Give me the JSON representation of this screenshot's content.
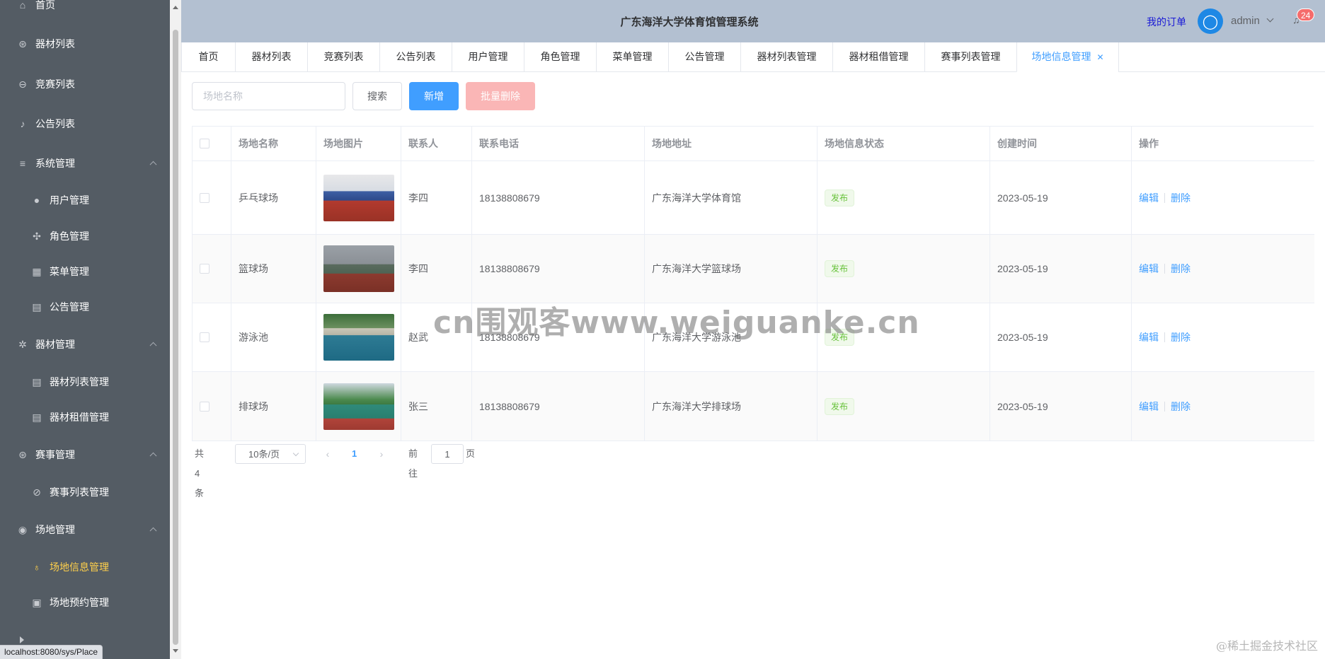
{
  "sidebar": {
    "items": [
      {
        "label": "首页",
        "icon": "home-icon",
        "glyph": "⌂"
      },
      {
        "label": "器材列表",
        "icon": "basketball-icon",
        "glyph": "⊛"
      },
      {
        "label": "竞赛列表",
        "icon": "football-icon",
        "glyph": "⊖"
      },
      {
        "label": "公告列表",
        "icon": "bell-icon",
        "glyph": "♪"
      },
      {
        "label": "系统管理",
        "icon": "sliders-icon",
        "glyph": "≡"
      },
      {
        "label": "用户管理",
        "icon": "user-icon",
        "glyph": "●"
      },
      {
        "label": "角色管理",
        "icon": "rank-icon",
        "glyph": "✣"
      },
      {
        "label": "菜单管理",
        "icon": "menu-grid-icon",
        "glyph": "▦"
      },
      {
        "label": "公告管理",
        "icon": "document-icon",
        "glyph": "▤"
      },
      {
        "label": "器材管理",
        "icon": "gear-icon",
        "glyph": "✲"
      },
      {
        "label": "器材列表管理",
        "icon": "document-icon",
        "glyph": "▤"
      },
      {
        "label": "器材租借管理",
        "icon": "document-icon",
        "glyph": "▤"
      },
      {
        "label": "赛事管理",
        "icon": "basketball-icon",
        "glyph": "⊛"
      },
      {
        "label": "赛事列表管理",
        "icon": "football-icon",
        "glyph": "⊘"
      },
      {
        "label": "场地管理",
        "icon": "location-icon",
        "glyph": "◉"
      },
      {
        "label": "场地信息管理",
        "icon": "user-outline-icon",
        "glyph": "♁"
      },
      {
        "label": "场地预约管理",
        "icon": "tickets-icon",
        "glyph": "▣"
      }
    ]
  },
  "header": {
    "title": "广东海洋大学体育馆管理系统",
    "orders_link": "我的订单",
    "username": "admin",
    "notification_count": "24"
  },
  "tabs": [
    "首页",
    "器材列表",
    "竞赛列表",
    "公告列表",
    "用户管理",
    "角色管理",
    "菜单管理",
    "公告管理",
    "器材列表管理",
    "器材租借管理",
    "赛事列表管理",
    "场地信息管理"
  ],
  "toolbar": {
    "search_placeholder": "场地名称",
    "search_label": "搜索",
    "add_label": "新增",
    "batch_delete_label": "批量删除"
  },
  "table": {
    "columns": [
      "场地名称",
      "场地图片",
      "联系人",
      "联系电话",
      "场地地址",
      "场地信息状态",
      "创建时间",
      "操作"
    ],
    "rows": [
      {
        "name": "乒乓球场",
        "contact": "李四",
        "phone": "18138808679",
        "address": "广东海洋大学体育馆",
        "status": "发布",
        "created": "2023-05-19"
      },
      {
        "name": "篮球场",
        "contact": "李四",
        "phone": "18138808679",
        "address": "广东海洋大学篮球场",
        "status": "发布",
        "created": "2023-05-19"
      },
      {
        "name": "游泳池",
        "contact": "赵武",
        "phone": "18138808679",
        "address": "广东海洋大学游泳池",
        "status": "发布",
        "created": "2023-05-19"
      },
      {
        "name": "排球场",
        "contact": "张三",
        "phone": "18138808679",
        "address": "广东海洋大学排球场",
        "status": "发布",
        "created": "2023-05-19"
      }
    ],
    "edit_label": "编辑",
    "delete_label": "删除"
  },
  "pagination": {
    "total": "共 4 条",
    "page_size": "10条/页",
    "current_page": "1",
    "goto_prefix": "前往",
    "goto_value": "1",
    "goto_suffix": "页"
  },
  "watermark": "cn围观客www.weiguanke.cn",
  "corner_watermark": "@稀土掘金技术社区",
  "status_url": "localhost:8080/sys/Place",
  "colors": {
    "primary": "#409eff",
    "sidebar_bg": "#545c64",
    "active_menu": "#ffd04b",
    "header_bg": "#b3c0d1",
    "danger_light": "#fab6b6",
    "success": "#67c23a"
  }
}
